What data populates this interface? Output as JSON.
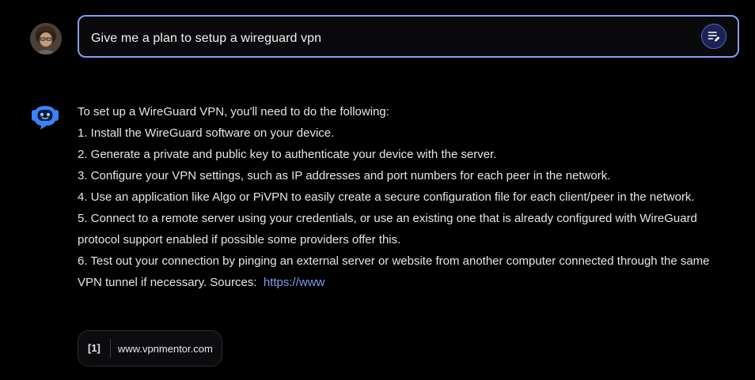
{
  "user": {
    "avatar_icon": "user-avatar-photo",
    "prompt": "Give me a plan to setup a wireguard vpn",
    "edit_icon": "edit-prompt-icon"
  },
  "assistant": {
    "avatar_icon": "bot-avatar-icon",
    "lines": [
      "To set up a WireGuard VPN, you'll need to do the following:",
      "1. Install the WireGuard software on your device.",
      "2. Generate a private and public key to authenticate your device with the server.",
      "3. Configure your VPN settings, such as IP addresses and port numbers for each peer in the network.",
      "4. Use an application like Algo or PiVPN to easily create a secure configuration file for each client/peer in the network.",
      "5. Connect to a remote server using your credentials, or use an existing one that is already configured with WireGuard protocol support enabled if possible some providers offer this.",
      "6. Test out your connection by pinging an external server or website from another computer connected through the same VPN tunnel if necessary. Sources:"
    ],
    "link_text": "https://www",
    "sources": [
      {
        "index": "[1]",
        "domain": "www.vpnmentor.com"
      }
    ]
  },
  "colors": {
    "background": "#000000",
    "prompt_border": "#7f9ff2",
    "link": "#7d9cf0",
    "bot_accent": "#3b82f6"
  }
}
